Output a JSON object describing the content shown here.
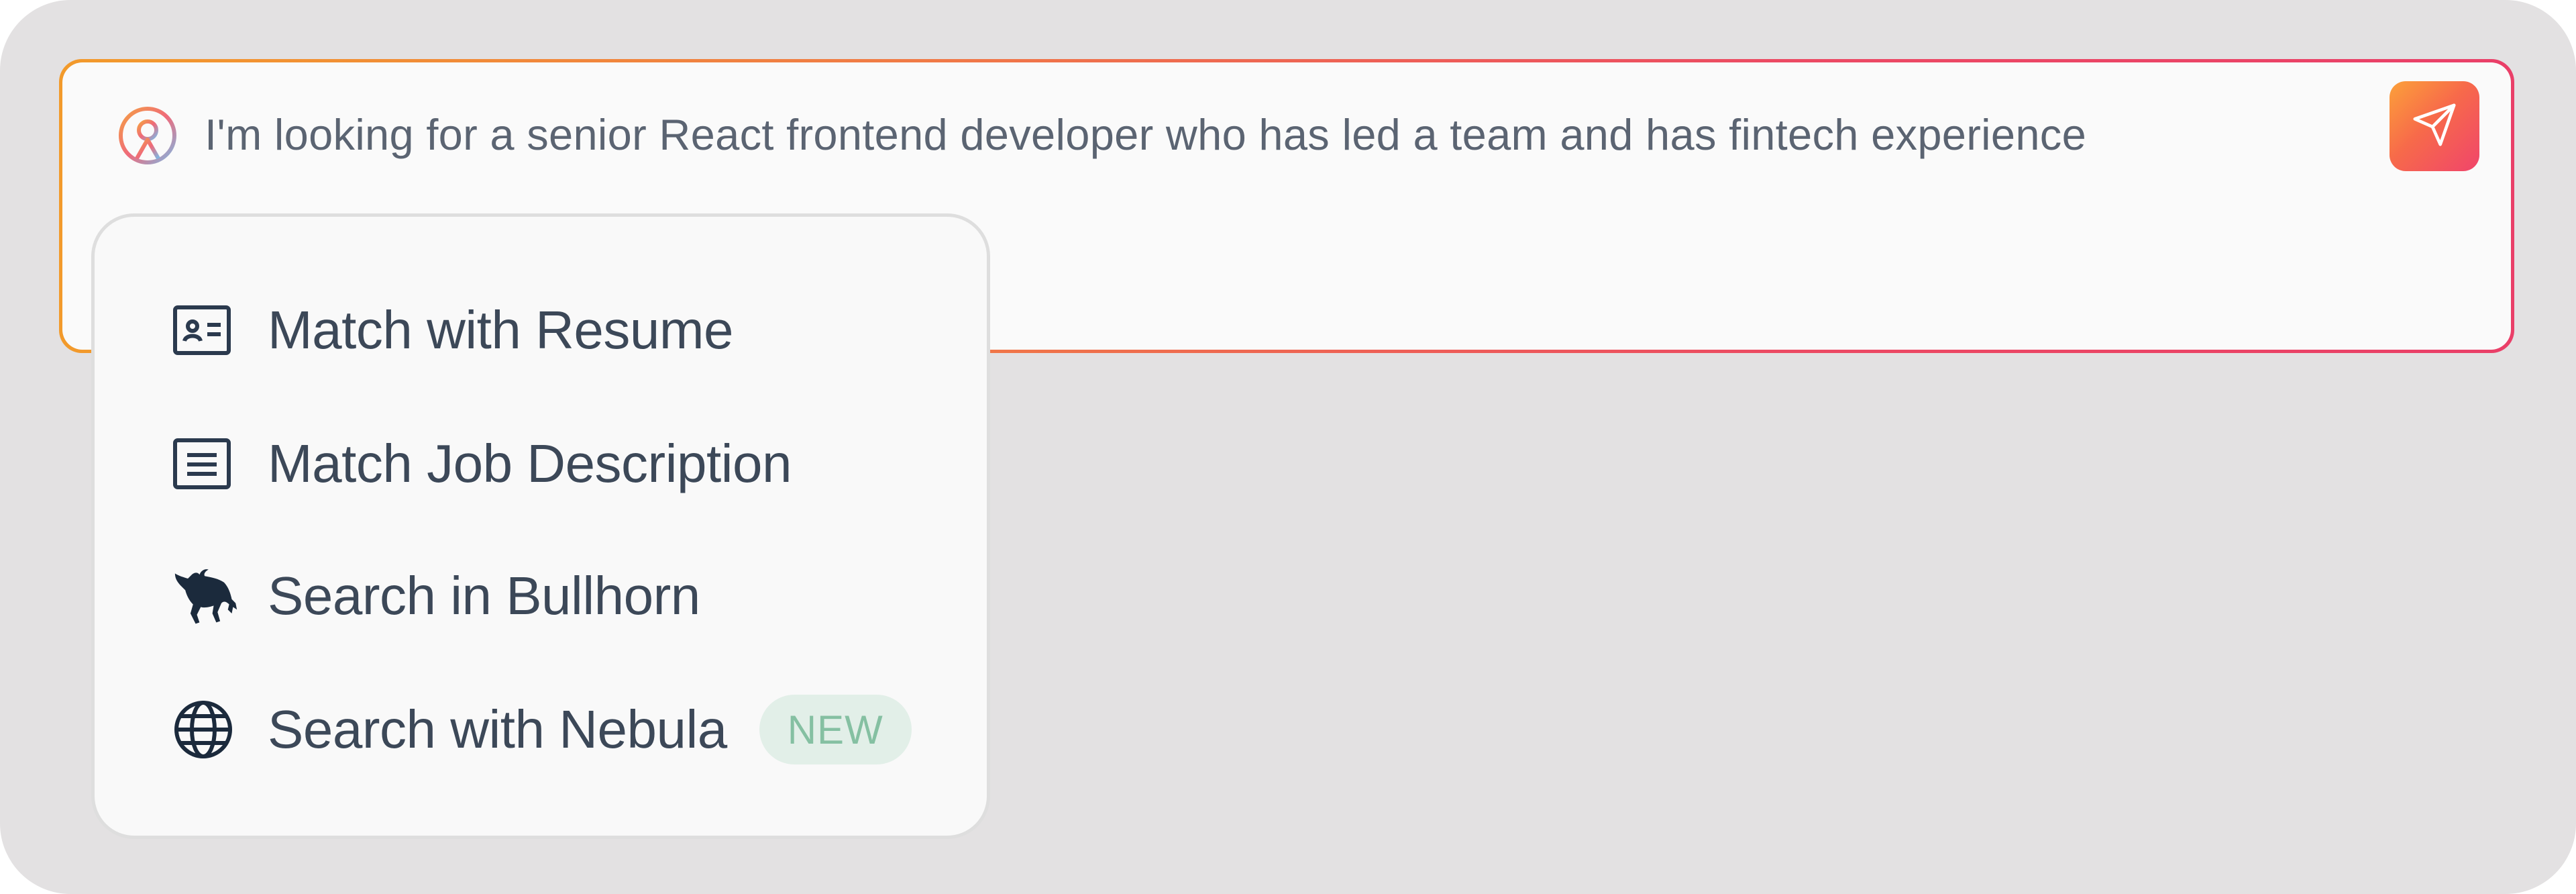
{
  "search": {
    "query": "I'm looking for a senior React frontend developer who has led a team and has fintech experience",
    "brand_icon": "person-pin-icon",
    "send_icon": "paper-plane-icon",
    "border_gradient": [
      "#f29a2b",
      "#ea3f68"
    ]
  },
  "menu": {
    "items": [
      {
        "label": "Match with Resume",
        "icon": "id-card-icon"
      },
      {
        "label": "Match Job Description",
        "icon": "document-lines-icon"
      },
      {
        "label": "Search in Bullhorn",
        "icon": "bull-icon"
      },
      {
        "label": "Search with Nebula",
        "icon": "globe-icon",
        "badge": "NEW"
      }
    ]
  },
  "colors": {
    "background": "#e3e1e2",
    "text": "#3c4858",
    "badge_bg": "#e2efe8",
    "badge_text": "#85c0a2",
    "icon": "#1f2e42"
  }
}
